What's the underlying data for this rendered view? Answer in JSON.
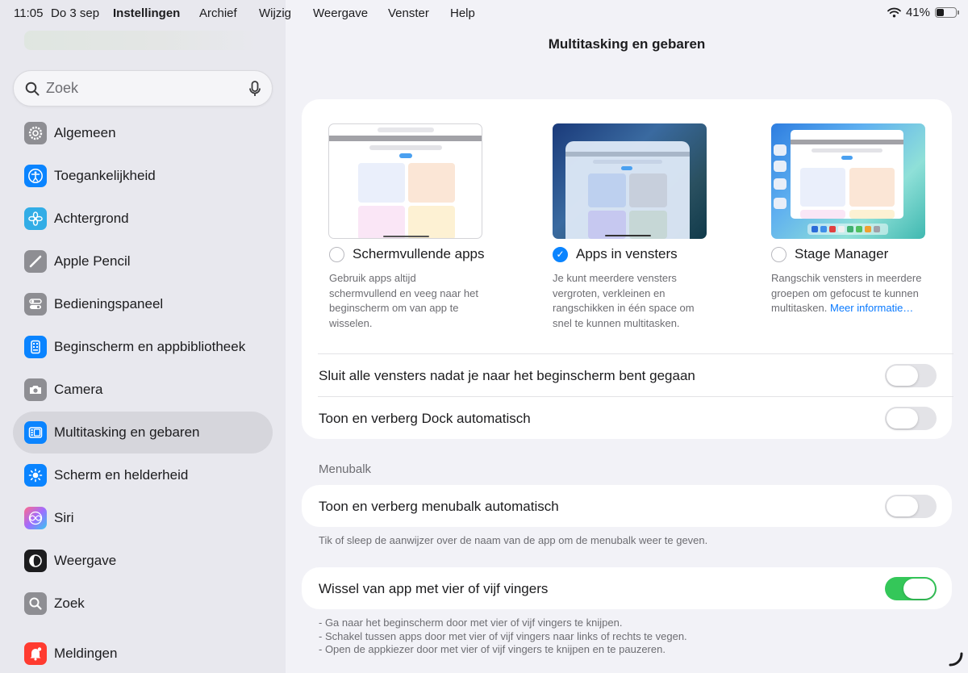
{
  "status": {
    "time": "11:05",
    "date": "Do 3 sep",
    "battery": "41%",
    "battery_level": 0.41
  },
  "menu": {
    "app": "Instellingen",
    "items": [
      "Archief",
      "Wijzig",
      "Weergave",
      "Venster",
      "Help"
    ]
  },
  "sidebar": {
    "search_placeholder": "Zoek",
    "items": [
      {
        "label": "Algemeen",
        "icon": "gear-icon",
        "color": "#8e8e93"
      },
      {
        "label": "Toegankelijkheid",
        "icon": "accessibility-icon",
        "color": "#0a84ff"
      },
      {
        "label": "Achtergrond",
        "icon": "flower-icon",
        "color": "#32ade6"
      },
      {
        "label": "Apple Pencil",
        "icon": "pencil-icon",
        "color": "#8e8e93"
      },
      {
        "label": "Bedieningspaneel",
        "icon": "switches-icon",
        "color": "#8e8e93"
      },
      {
        "label": "Beginscherm en appbibliotheek",
        "icon": "home-screen-icon",
        "color": "#0a84ff"
      },
      {
        "label": "Camera",
        "icon": "camera-icon",
        "color": "#8e8e93"
      },
      {
        "label": "Multitasking en gebaren",
        "icon": "multitasking-icon",
        "color": "#0a84ff"
      },
      {
        "label": "Scherm en helderheid",
        "icon": "sun-icon",
        "color": "#0a84ff"
      },
      {
        "label": "Siri",
        "icon": "siri-icon",
        "color": "#ff6b8b"
      },
      {
        "label": "Weergave",
        "icon": "display-icon",
        "color": "#1c1c1e"
      },
      {
        "label": "Zoek",
        "icon": "search-icon",
        "color": "#8e8e93"
      },
      {
        "label": "Meldingen",
        "icon": "bell-icon",
        "color": "#ff3b30"
      }
    ]
  },
  "main": {
    "title": "Multitasking en gebaren",
    "options": [
      {
        "label": "Schermvullende apps",
        "checked": false,
        "desc": "Gebruik apps altijd schermvullend en veeg naar het beginscherm om van app te wisselen."
      },
      {
        "label": "Apps in vensters",
        "checked": true,
        "desc": "Je kunt meerdere vensters vergroten, verkleinen en rangschikken in één space om snel te kunnen multitasken."
      },
      {
        "label": "Stage Manager",
        "checked": false,
        "desc": "Rangschik vensters in meerdere groepen om gefocust te kunnen multitasken.",
        "link": "Meer informatie…"
      }
    ],
    "toggles": [
      {
        "label": "Sluit alle vensters nadat je naar het beginscherm bent gegaan",
        "on": false
      },
      {
        "label": "Toon en verberg Dock automatisch",
        "on": false
      }
    ],
    "menubalk": {
      "header": "Menubalk",
      "toggle_label": "Toon en verberg menubalk automatisch",
      "toggle_on": false,
      "footnote": "Tik of sleep de aanwijzer over de naam van de app om de menubalk weer te geven."
    },
    "gestures": {
      "toggle_label": "Wissel van app met vier of vijf vingers",
      "toggle_on": true,
      "notes": [
        "- Ga naar het beginscherm door met vier of vijf vingers te knijpen.",
        "- Schakel tussen apps door met vier of vijf vingers naar links of rechts te vegen.",
        "- Open de appkiezer door met vier of vijf vingers te knijpen en te pauzeren."
      ]
    }
  }
}
